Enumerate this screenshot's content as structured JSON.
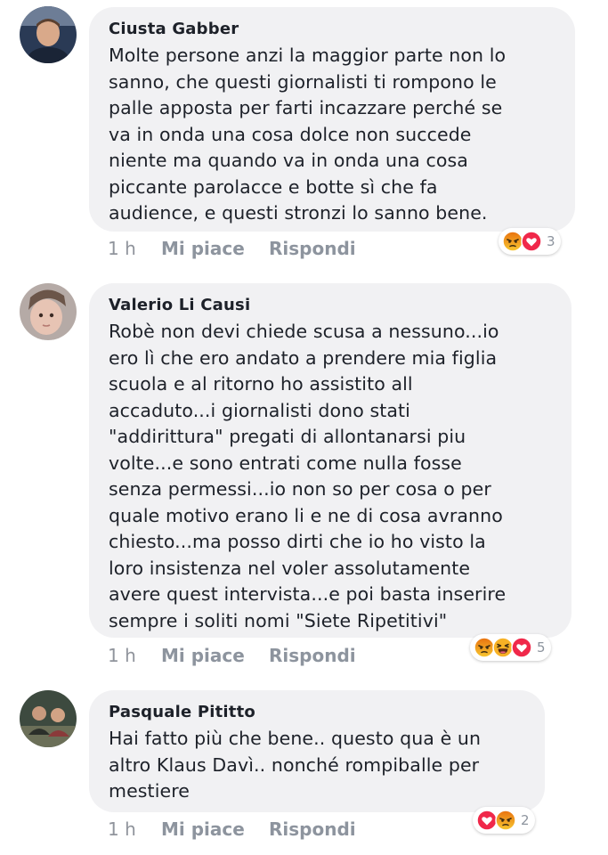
{
  "comments": [
    {
      "author": "Ciusta Gabber",
      "text": "Molte persone anzi la maggior parte non lo\nsanno, che questi giornalisti ti rompono le\npalle apposta per farti incazzare perché se\nva in onda una cosa dolce non succede\nniente ma quando va in onda una cosa\npiccante parolacce e botte sì che fa\naudience, e questi stronzi lo sanno bene.",
      "time": "1 h",
      "like_label": "Mi piace",
      "reply_label": "Rispondi",
      "reaction_icons": [
        "angry-icon",
        "love-icon"
      ],
      "reaction_count": "3"
    },
    {
      "author": "Valerio Li Causi",
      "text": "Robè non devi chiede scusa a nessuno...io\nero lì che ero andato a prendere mia figlia\nscuola e al ritorno ho assistito all\naccaduto...i giornalisti dono stati\n\"addirittura\" pregati di allontanarsi piu\nvolte...e sono entrati come nulla fosse\nsenza permessi...io non so per cosa o per\nquale motivo erano li e ne di cosa avranno\nchiesto...ma posso dirti che io ho visto la\nloro insistenza nel voler assolutamente\navere quest intervista...e poi basta inserire\nsempre i soliti nomi \"Siete Ripetitivi\"",
      "time": "1 h",
      "like_label": "Mi piace",
      "reply_label": "Rispondi",
      "reaction_icons": [
        "angry-icon",
        "haha-icon",
        "love-icon"
      ],
      "reaction_count": "5"
    },
    {
      "author": "Pasquale Pititto",
      "text": "Hai fatto più che bene.. questo qua è un\naltro Klaus Davì.. nonché rompiballe per\nmestiere",
      "time": "1 h",
      "like_label": "Mi piace",
      "reply_label": "Rispondi",
      "reaction_icons": [
        "love-icon",
        "angry-icon"
      ],
      "reaction_count": "2"
    }
  ],
  "colors": {
    "bubble": "#f1f1f3",
    "text": "#1d2129",
    "meta": "#90949c",
    "love": "#f0284a",
    "angry_top": "#e9710f",
    "haha": "#f7b125"
  }
}
